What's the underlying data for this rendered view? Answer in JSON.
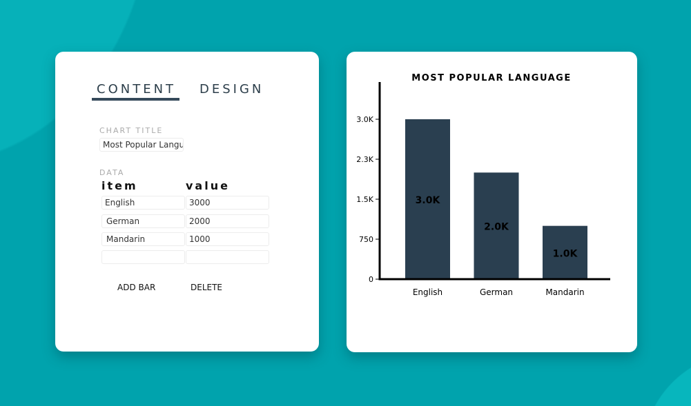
{
  "editor": {
    "tabs": [
      {
        "label": "CONTENT",
        "active": true
      },
      {
        "label": "DESIGN",
        "active": false
      }
    ],
    "chart_title_label": "CHART TITLE",
    "chart_title_value": "Most Popular Langua",
    "data_label": "DATA",
    "col_item": "item",
    "col_value": "value",
    "rows": [
      {
        "item": "English",
        "value": "3000"
      },
      {
        "item": "German",
        "value": "2000"
      },
      {
        "item": "Mandarin",
        "value": "1000"
      },
      {
        "item": "",
        "value": ""
      }
    ],
    "add_bar": "ADD BAR",
    "delete": "DELETE"
  },
  "colors": {
    "background": "#00a3ad",
    "bar": "#2a3f50",
    "axis": "#000000"
  },
  "chart_data": {
    "type": "bar",
    "title": "MOST POPULAR LANGUAGE",
    "categories": [
      "English",
      "German",
      "Mandarin"
    ],
    "values": [
      3000,
      2000,
      1000
    ],
    "data_labels": [
      "3.0K",
      "2.0K",
      "1.0K"
    ],
    "yticks": [
      0,
      750,
      1500,
      2250,
      3000
    ],
    "ytick_labels": [
      "0",
      "750",
      "1.5K",
      "2.3K",
      "3.0K"
    ],
    "ylim": [
      0,
      3700
    ],
    "grid": false
  }
}
